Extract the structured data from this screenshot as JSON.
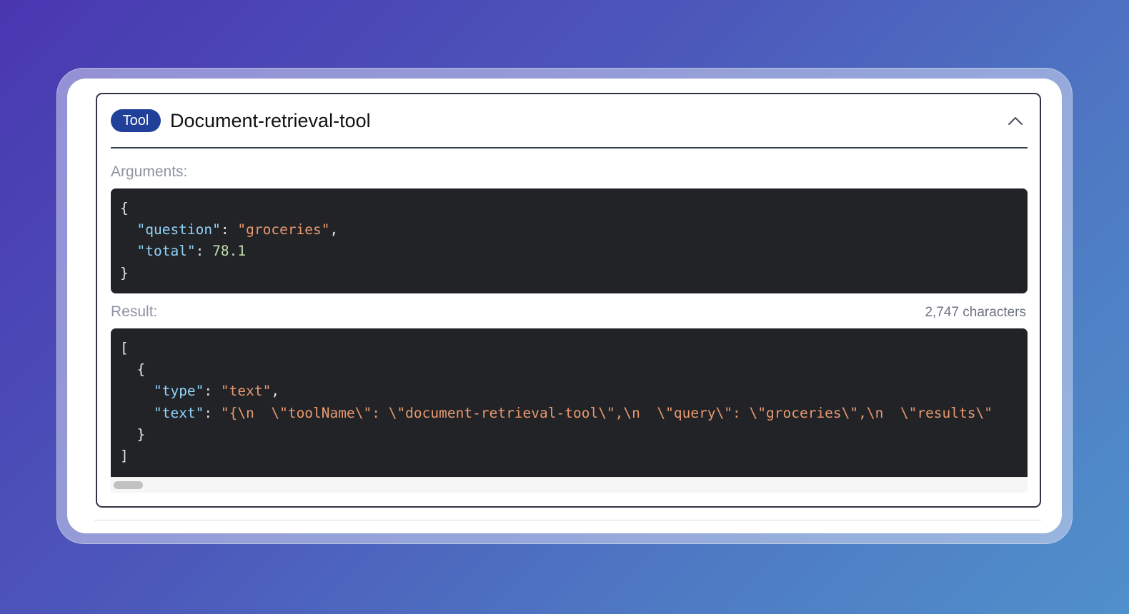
{
  "tool": {
    "badge": "Tool",
    "name": "Document-retrieval-tool"
  },
  "arguments": {
    "label": "Arguments:",
    "lines": [
      {
        "open": "{"
      },
      {
        "key": "\"question\"",
        "sep": ": ",
        "value": "\"groceries\"",
        "end": ",",
        "type": "string"
      },
      {
        "key": "\"total\"",
        "sep": ": ",
        "value": "78.1",
        "end": "",
        "type": "number"
      },
      {
        "close": "}"
      }
    ]
  },
  "result": {
    "label": "Result:",
    "char_count": "2,747 characters",
    "open_bracket": "[",
    "open_brace": "{",
    "type_key": "\"type\"",
    "type_value": "\"text\"",
    "text_key": "\"text\"",
    "text_value": "\"{\\n  \\\"toolName\\\": \\\"document-retrieval-tool\\\",\\n  \\\"query\\\": \\\"groceries\\\",\\n  \\\"results\\\"",
    "close_brace": "}",
    "close_bracket": "]"
  },
  "icons": {
    "collapse": "chevron-up-icon"
  }
}
